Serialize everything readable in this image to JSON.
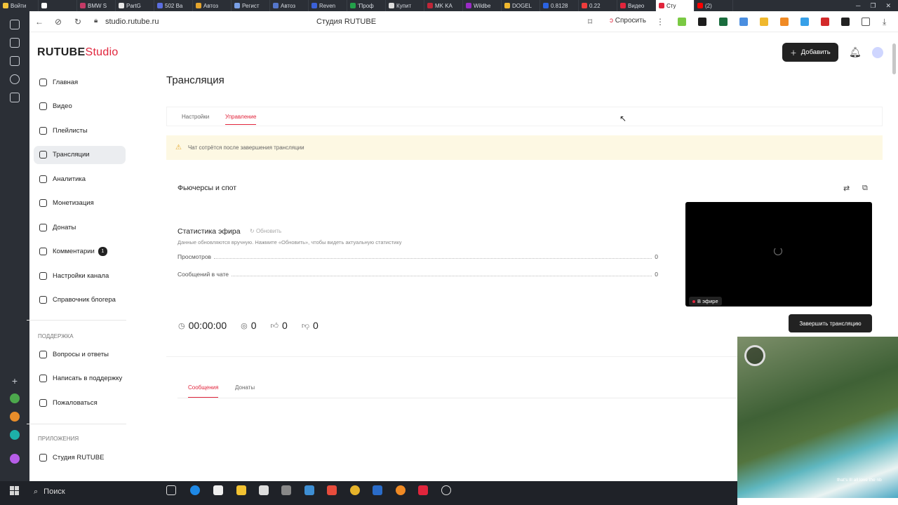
{
  "browser": {
    "tabs": [
      {
        "label": "Войти",
        "color": "#f3c43b"
      },
      {
        "label": "",
        "color": "#ffffff"
      },
      {
        "label": "BMW S",
        "color": "#c33a66"
      },
      {
        "label": "PartG",
        "color": "#e7e7e7"
      },
      {
        "label": "502 Ba",
        "color": "#5b6ee0"
      },
      {
        "label": "Автоз",
        "color": "#e5a52d"
      },
      {
        "label": "Регист",
        "color": "#7aa0e6"
      },
      {
        "label": "Автоз",
        "color": "#5577cc"
      },
      {
        "label": "Reven",
        "color": "#3b61d9"
      },
      {
        "label": "'Проф",
        "color": "#23a14a"
      },
      {
        "label": "Купит",
        "color": "#dddddd"
      },
      {
        "label": "MK KA",
        "color": "#c02638"
      },
      {
        "label": "Wildbe",
        "color": "#9b2bc6"
      },
      {
        "label": "DOGEL",
        "color": "#f0b82e"
      },
      {
        "label": "0.8128",
        "color": "#2b63e2"
      },
      {
        "label": "0.22",
        "color": "#ef3c3c"
      },
      {
        "label": "Видео",
        "color": "#e1253c"
      },
      {
        "label": "Сту",
        "color": "#e1253c"
      },
      {
        "label": "(2)",
        "color": "#ff0000"
      }
    ],
    "url": "studio.rutube.ru",
    "page_title": "Студия RUTUBE",
    "ask_label": "Спросить"
  },
  "app": {
    "logo": {
      "main": "RUTUBE",
      "accent": "Studio"
    },
    "add_button": "Добавить",
    "page_heading": "Трансляция",
    "tabs": [
      "Настройки",
      "Управление"
    ],
    "warning": "Чат сотрётся после завершения трансляции",
    "stream_title": "Фьючерсы и спот",
    "live_label": "В эфире",
    "stats": {
      "heading": "Статистика эфира",
      "refresh": "Обновить",
      "hint": "Данные обновляются вручную. Нажмите «Обновить», чтобы видеть актуальную статистику",
      "rows": [
        {
          "label": "Просмотров",
          "value": "0"
        },
        {
          "label": "Сообщений в чате",
          "value": "0"
        }
      ]
    },
    "metrics": {
      "timer": "00:00:00",
      "viewers": "0",
      "likes": "0",
      "dislikes": "0"
    },
    "end_button": "Завершить трансляцию",
    "chat_tabs": [
      "Сообщения",
      "Донаты"
    ]
  },
  "sidebar": {
    "items": [
      {
        "label": "Главная"
      },
      {
        "label": "Видео"
      },
      {
        "label": "Плейлисты"
      },
      {
        "label": "Трансляции",
        "selected": true
      },
      {
        "label": "Аналитика"
      },
      {
        "label": "Монетизация"
      },
      {
        "label": "Донаты"
      },
      {
        "label": "Комментарии",
        "badge": "1"
      },
      {
        "label": "Настройки канала"
      },
      {
        "label": "Справочник блогера"
      }
    ],
    "support_heading": "ПОДДЕРЖКА",
    "support_items": [
      {
        "label": "Вопросы и ответы"
      },
      {
        "label": "Написать в поддержку"
      },
      {
        "label": "Пожаловаться"
      }
    ],
    "apps_heading": "ПРИЛОЖЕНИЯ",
    "apps_items": [
      {
        "label": "Студия RUTUBE"
      }
    ]
  },
  "pip": {
    "caption": "that's Ill all love the nb"
  },
  "taskbar": {
    "search": "Поиск"
  }
}
